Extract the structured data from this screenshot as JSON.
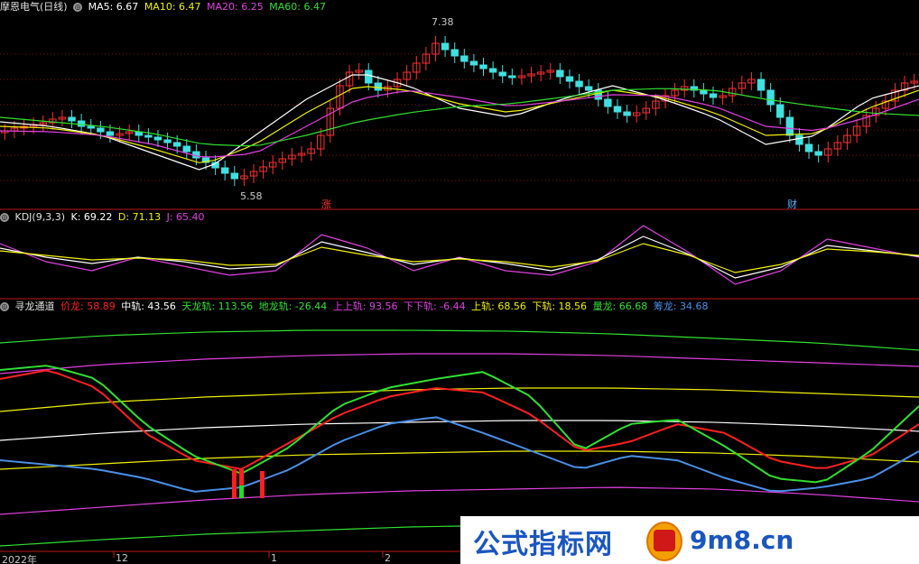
{
  "price_panel": {
    "title": "摩恩电气(日线)",
    "ma_labels": [
      {
        "text": "MA5: 6.67",
        "color": "#ffffff"
      },
      {
        "text": "MA10: 6.47",
        "color": "#f0f000"
      },
      {
        "text": "MA20: 6.25",
        "color": "#e040e0"
      },
      {
        "text": "MA60: 6.47",
        "color": "#30e030"
      }
    ],
    "high_label": "7.38",
    "low_label": "5.58",
    "marker_zhang": "涨",
    "marker_cai": "财"
  },
  "kdj_panel": {
    "title": "KDJ(9,3,3)",
    "labels": [
      {
        "text": "K: 69.22",
        "color": "#ffffff"
      },
      {
        "text": "D: 71.13",
        "color": "#f0f000"
      },
      {
        "text": "J: 65.40",
        "color": "#e040e0"
      }
    ]
  },
  "channel_panel": {
    "title": "寻龙通道",
    "labels": [
      {
        "text": "价龙: 58.89",
        "color": "#ff2020"
      },
      {
        "text": "中轨: 43.56",
        "color": "#ffffff"
      },
      {
        "text": "天龙轨: 113.56",
        "color": "#30e030"
      },
      {
        "text": "地龙轨: -26.44",
        "color": "#30e030"
      },
      {
        "text": "上上轨: 93.56",
        "color": "#e040e0"
      },
      {
        "text": "下下轨: -6.44",
        "color": "#e040e0"
      },
      {
        "text": "上轨: 68.56",
        "color": "#f0f000"
      },
      {
        "text": "下轨: 18.56",
        "color": "#f0f000"
      },
      {
        "text": "量龙: 66.68",
        "color": "#30e030"
      },
      {
        "text": "筹龙: 34.68",
        "color": "#4a90e8"
      }
    ]
  },
  "x_axis": {
    "year": "2022年",
    "m12": "12",
    "m1": "1",
    "m2": "2"
  },
  "watermark": {
    "text": "公式指标网",
    "url": "9m8.cn"
  }
}
